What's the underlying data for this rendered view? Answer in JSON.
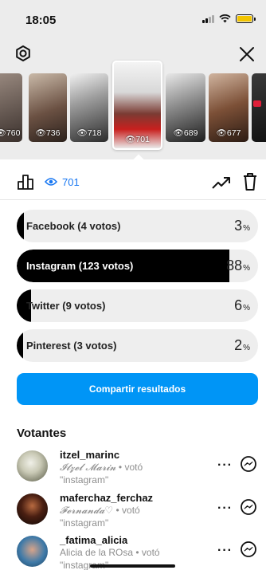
{
  "status_bar": {
    "time": "18:05",
    "battery_color": "#f2c400"
  },
  "header": {
    "settings_icon": "gear-icon",
    "close_icon": "close-icon"
  },
  "thumbnails": [
    {
      "views": "760"
    },
    {
      "views": "736"
    },
    {
      "views": "718"
    },
    {
      "views": "701",
      "selected": true
    },
    {
      "views": "689"
    },
    {
      "views": "677"
    }
  ],
  "stats": {
    "view_count": "701",
    "accent_color": "#1877f2"
  },
  "poll": {
    "options": [
      {
        "label": "Facebook (4 votos)",
        "percent": "3",
        "percent_symbol": "%",
        "value": 3
      },
      {
        "label": "Instagram (123 votos)",
        "percent": "88",
        "percent_symbol": "%",
        "value": 88
      },
      {
        "label": "Twitter (9 votos)",
        "percent": "6",
        "percent_symbol": "%",
        "value": 6
      },
      {
        "label": "Pinterest (3 votos)",
        "percent": "2",
        "percent_symbol": "%",
        "value": 2
      }
    ]
  },
  "share_button": {
    "label": "Compartir resultados",
    "color": "#0095f6"
  },
  "voters_section": {
    "title": "Votantes",
    "voters": [
      {
        "username": "itzel_marinc",
        "display_name": "𝓘𝓽𝔃𝓮𝓵 𝓜𝓪𝓻𝓲𝓷",
        "voted_text": "• votó",
        "choice": "\"instagram\""
      },
      {
        "username": "maferchaz_ferchaz",
        "display_name": "𝓕𝓮𝓻𝓷𝓪𝓷𝓭𝓪♡",
        "voted_text": "• votó",
        "choice": "\"instagram\""
      },
      {
        "username": "_fatima_alicia",
        "display_name": "Alicia de la ROsa",
        "voted_text": "• votó",
        "choice": "\"instagram\""
      }
    ]
  }
}
